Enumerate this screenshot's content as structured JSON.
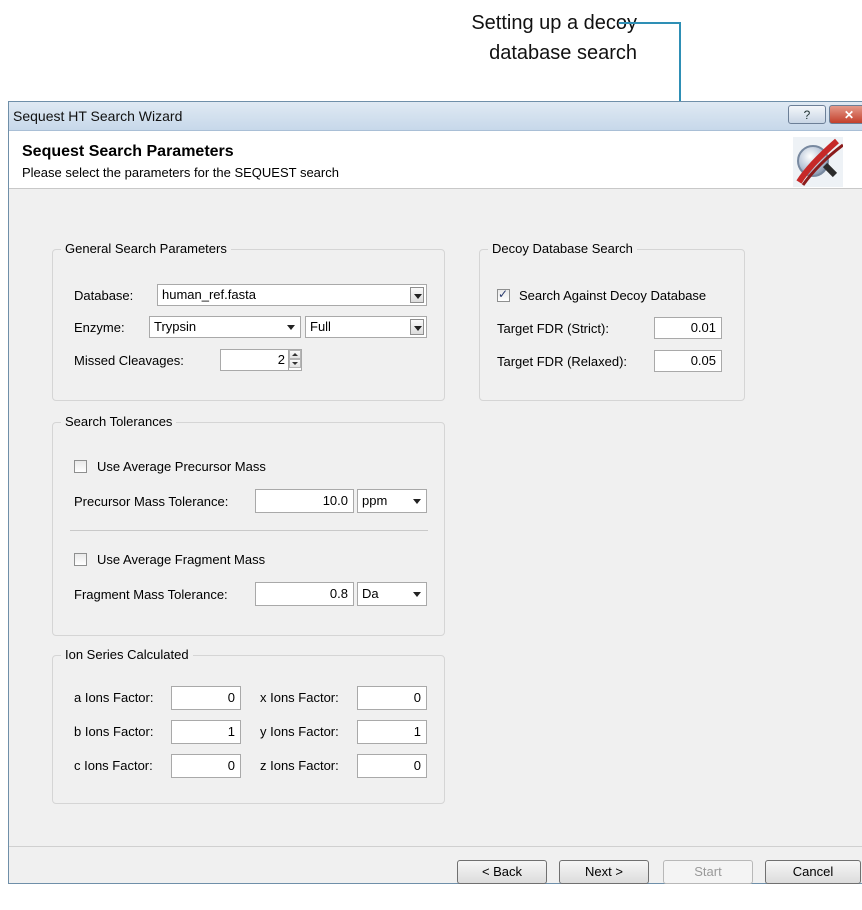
{
  "annotation": {
    "line1": "Setting up a decoy",
    "line2": "database search"
  },
  "window": {
    "title": "Sequest HT Search Wizard",
    "help_label": "?",
    "close_label": "✕"
  },
  "header": {
    "title": "Sequest Search Parameters",
    "subtitle": "Please select the parameters for the SEQUEST search"
  },
  "general": {
    "legend": "General Search Parameters",
    "database_label": "Database:",
    "database_value": "human_ref.fasta",
    "enzyme_label": "Enzyme:",
    "enzyme_value": "Trypsin",
    "enzyme_specificity": "Full",
    "missed_label": "Missed Cleavages:",
    "missed_value": "2"
  },
  "decoy": {
    "legend": "Decoy Database Search",
    "checkbox_label": "Search Against Decoy Database",
    "checked": true,
    "strict_label": "Target FDR (Strict):",
    "strict_value": "0.01",
    "relaxed_label": "Target FDR (Relaxed):",
    "relaxed_value": "0.05"
  },
  "tolerances": {
    "legend": "Search Tolerances",
    "avg_precursor_label": "Use Average Precursor Mass",
    "precursor_tol_label": "Precursor Mass Tolerance:",
    "precursor_tol_value": "10.0",
    "precursor_unit": "ppm",
    "avg_fragment_label": "Use Average Fragment Mass",
    "fragment_tol_label": "Fragment Mass Tolerance:",
    "fragment_tol_value": "0.8",
    "fragment_unit": "Da"
  },
  "ions": {
    "legend": "Ion Series Calculated",
    "a_label": "a Ions Factor:",
    "a_value": "0",
    "b_label": "b Ions Factor:",
    "b_value": "1",
    "c_label": "c Ions Factor:",
    "c_value": "0",
    "x_label": "x Ions Factor:",
    "x_value": "0",
    "y_label": "y Ions Factor:",
    "y_value": "1",
    "z_label": "z Ions Factor:",
    "z_value": "0"
  },
  "buttons": {
    "back": "< Back",
    "next": "Next >",
    "start": "Start",
    "cancel": "Cancel"
  },
  "colors": {
    "callout_line": "#2e8fb5",
    "dialog_bg": "#f0f0f0"
  }
}
